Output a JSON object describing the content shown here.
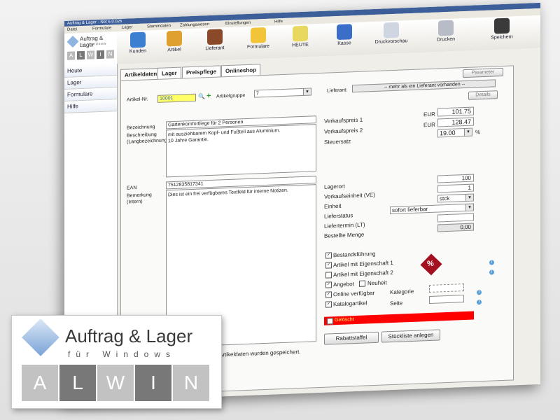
{
  "window": {
    "title": "Auftrag & Lager - Net 6.0.026"
  },
  "menubar": [
    "Datei",
    "Formulare",
    "Lager",
    "Stammdaten",
    "Zahlungswesen",
    "Einstellungen",
    "Hilfe"
  ],
  "toolbar": [
    {
      "label": "Kunden",
      "icon": "users-icon",
      "color": "#3a7fd0"
    },
    {
      "label": "Artikel",
      "icon": "cart-icon",
      "color": "#e0a030"
    },
    {
      "label": "Lieferant",
      "icon": "book-icon",
      "color": "#8a4a2a"
    },
    {
      "label": "Formulare",
      "icon": "folder-icon",
      "color": "#f2c43a"
    },
    {
      "label": "HEUTE",
      "icon": "note-check-icon",
      "color": "#e8d860"
    },
    {
      "label": "Kasse",
      "icon": "cash-register-icon",
      "color": "#3a6ec8"
    },
    {
      "label": "Druckvorschau",
      "icon": "print-preview-icon",
      "color": "#cfd6e2"
    },
    {
      "label": "Drucken",
      "icon": "printer-icon",
      "color": "#b7bcc6"
    },
    {
      "label": "Speichern",
      "icon": "floppy-disk-icon",
      "color": "#3a3a3a"
    }
  ],
  "logo": {
    "title": "Auftrag & Lager",
    "subtitle": "für Windows",
    "letters": [
      "A",
      "L",
      "W",
      "I",
      "N"
    ]
  },
  "sidebar": [
    "Heute",
    "Lager",
    "Formulare",
    "Hilfe"
  ],
  "tabs": [
    "Artikeldaten",
    "Lager",
    "Preispflege",
    "Onlineshop"
  ],
  "buttons": {
    "parameter": "Parameter",
    "details": "Details",
    "rabattstaffel": "Rabattstaffel",
    "stueckliste": "Stückliste anlegen"
  },
  "form": {
    "artikel_nr_label": "Artikel-Nr.",
    "artikel_nr_value": "10001",
    "artikelgruppe_label": "Artikelgruppe",
    "artikelgruppe_value": "7",
    "lieferant_label": "Lieferant:",
    "lieferant_value": "-- mehr als ein Lieferant vorhanden --",
    "bezeichnung_label": "Bezeichnung",
    "bezeichnung_value": "Gartenkomfortliege für 2 Personen",
    "beschreibung_label": "Beschreibung\n(Langbezeichnung)",
    "beschreibung_value": "mit ausziehbarem Kopf- und Fußteil aus Aluminium.\n10 Jahre Garantie.",
    "ean_label": "EAN",
    "ean_value": "7512835817341",
    "bemerkung_label": "Bemerkung\n(Intern)",
    "bemerkung_value": "Dies ist ein frei verfügbares Textfeld für interne Notizen.",
    "vk1_label": "Verkaufspreis 1",
    "vk1_currency": "EUR",
    "vk1_value": "101.75",
    "vk2_label": "Verkaufspreis 2",
    "vk2_currency": "EUR",
    "vk2_value": "128.47",
    "steuersatz_label": "Steuersatz",
    "steuersatz_value": "19.00",
    "steuersatz_unit": "%",
    "lagerort_label": "Lagerort",
    "lagerort_value": "100",
    "ve_label": "Verkaufseinheit (VE)",
    "ve_value": "1",
    "einheit_label": "Einheit",
    "einheit_value": "stck",
    "lieferstatus_label": "Lieferstatus",
    "lieferstatus_value": "sofort lieferbar",
    "liefertermin_label": "Liefertermin (LT)",
    "bestellte_menge_label": "Bestellte Menge",
    "bestellte_menge_value": "0,00"
  },
  "checks": [
    {
      "label": "Bestandsführung",
      "checked": true
    },
    {
      "label": "Artikel mit Eigenschaft 1",
      "checked": true
    },
    {
      "label": "Artikel mit Eigenschaft 2",
      "checked": false
    },
    {
      "label": "Angebot",
      "checked": true
    },
    {
      "label": "Neuheit",
      "checked": false
    },
    {
      "label": "Online verfügbar",
      "checked": true
    },
    {
      "label": "Katalogartikel",
      "checked": true
    }
  ],
  "kategorie_label": "Kategorie",
  "seite_label": "Seite",
  "geloescht_label": "Gelöscht",
  "status_message": "Artikeldaten wurden gespeichert.",
  "colors": {
    "deleted_bar": "#ff0000",
    "highlight_field": "#ffff66",
    "titlebar": "#3d5f99"
  }
}
